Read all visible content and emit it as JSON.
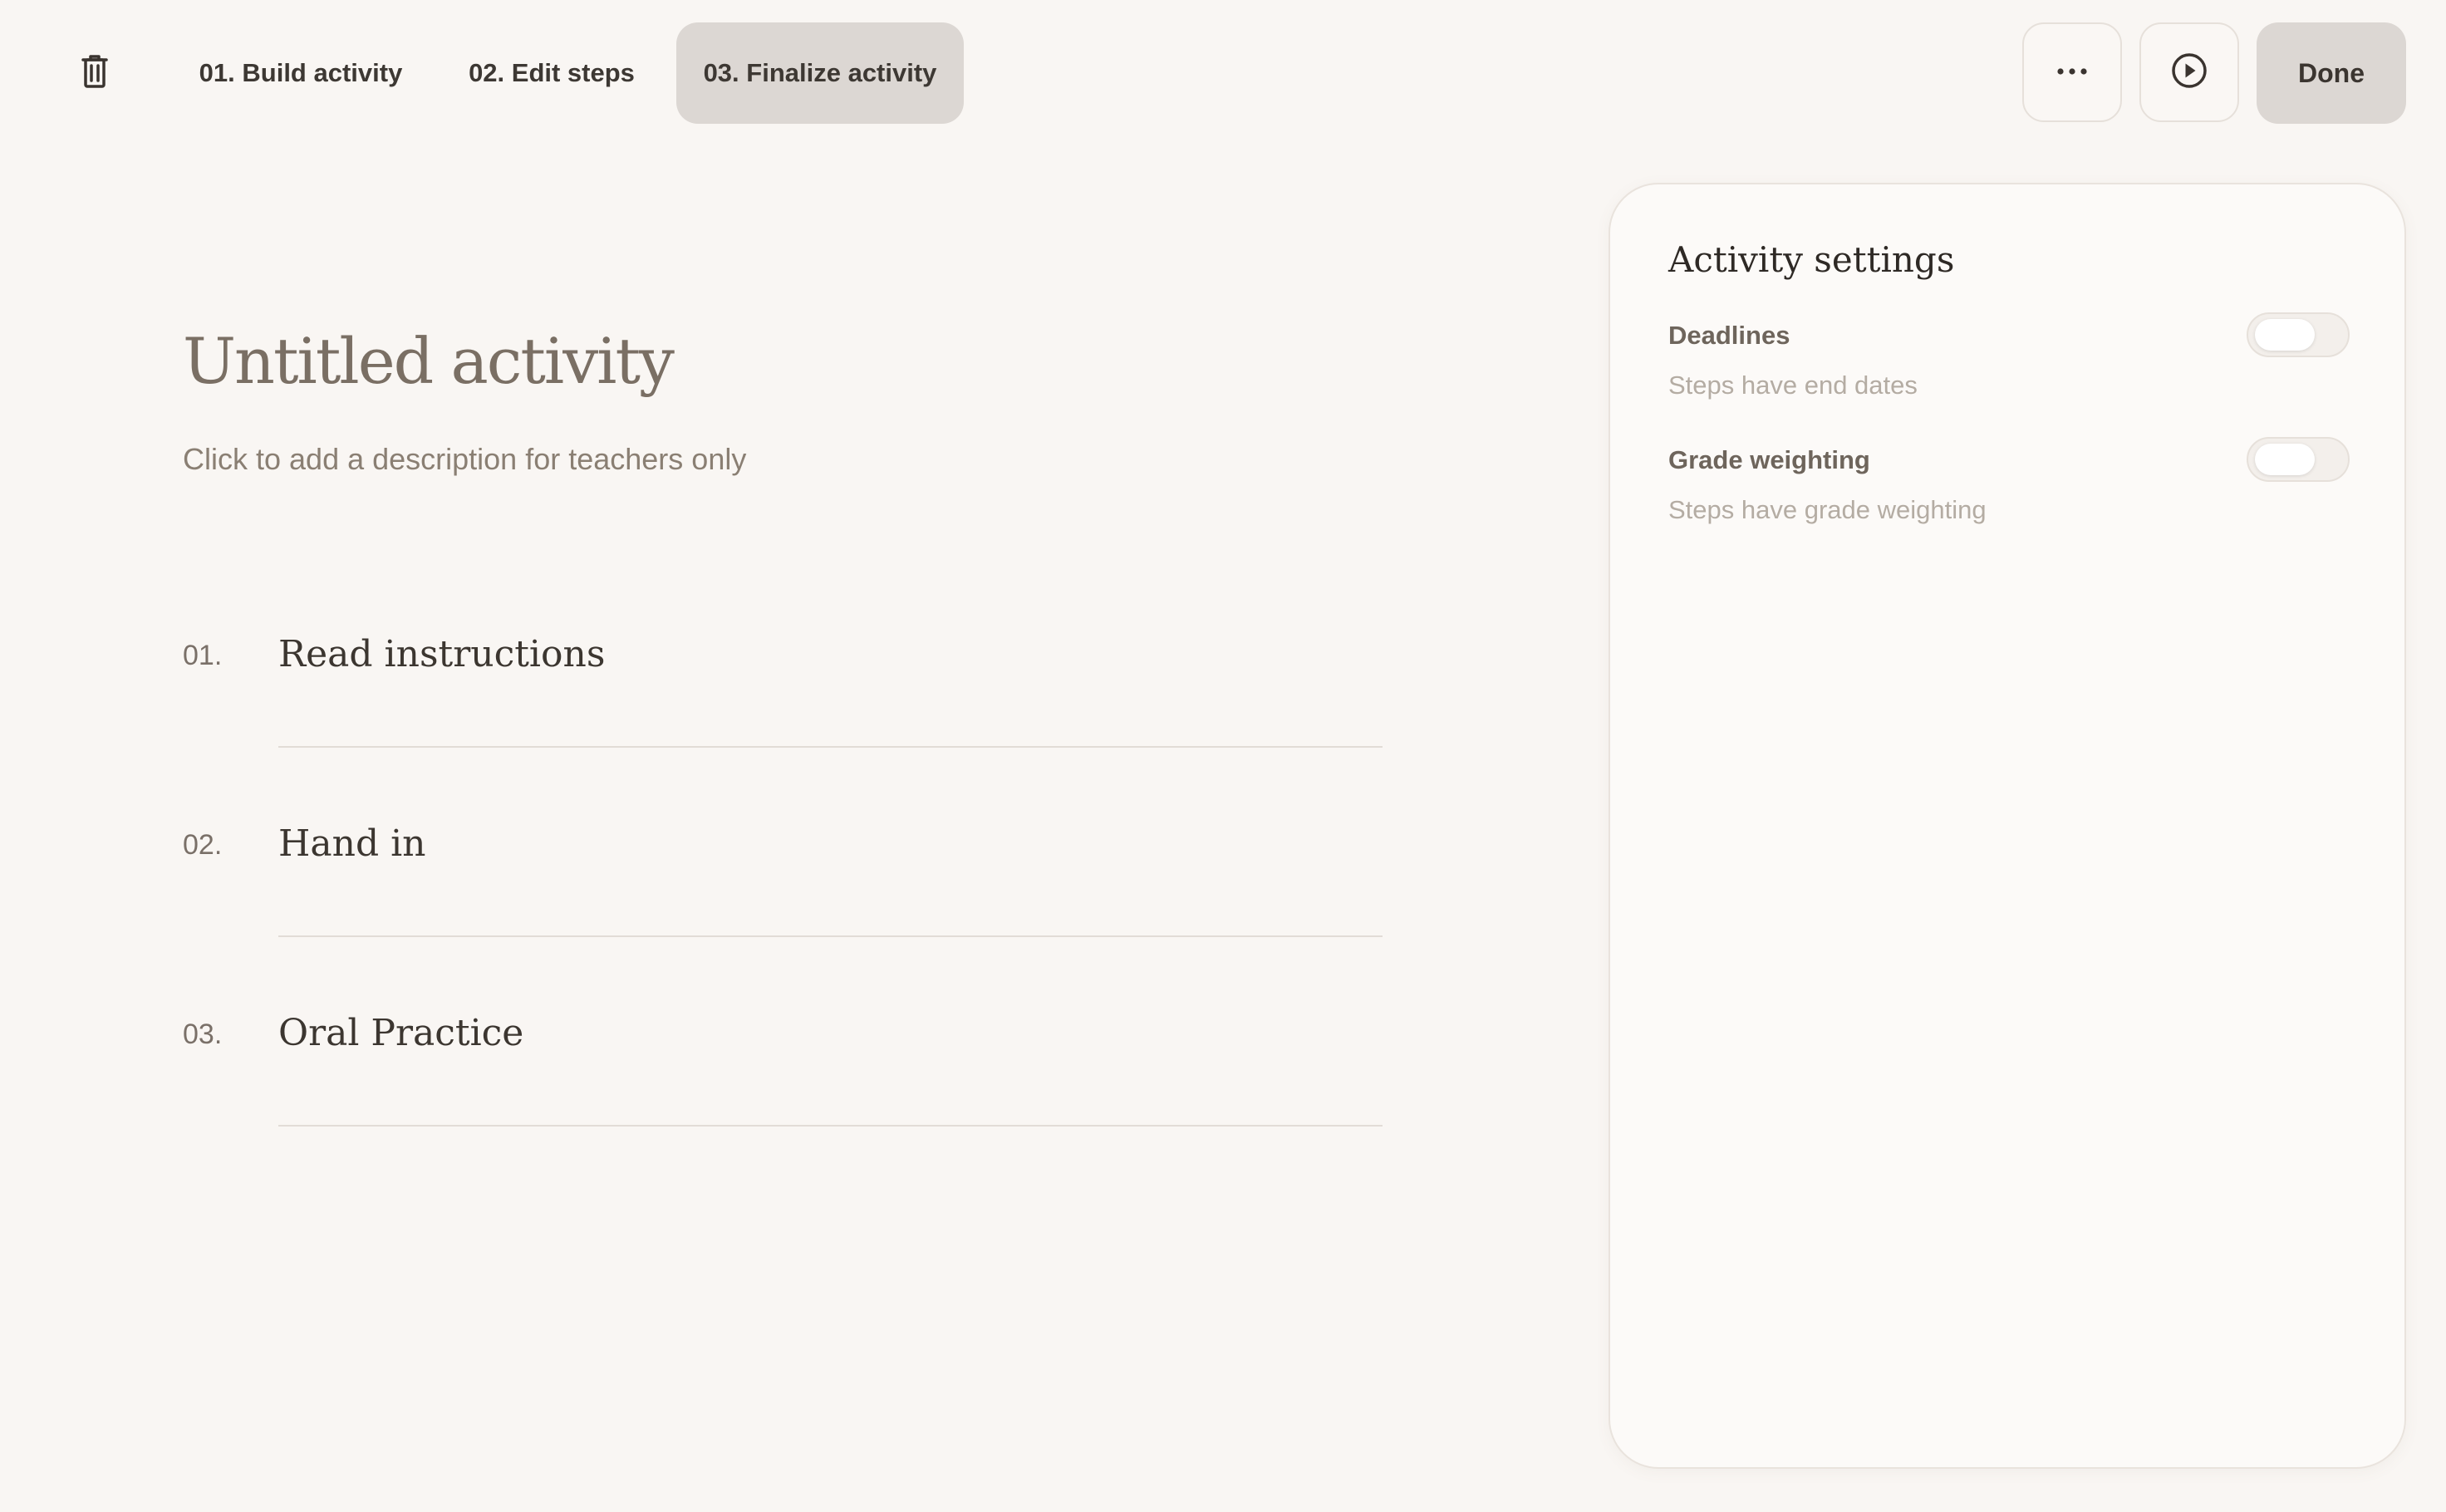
{
  "header": {
    "delete_icon": "trash-icon",
    "tabs": [
      {
        "label": "01. Build activity",
        "active": false
      },
      {
        "label": "02. Edit steps",
        "active": false
      },
      {
        "label": "03. Finalize activity",
        "active": true
      }
    ],
    "more_icon": "ellipsis-icon",
    "preview_icon": "play-circle-icon",
    "done_label": "Done"
  },
  "activity": {
    "title": "Untitled activity",
    "description_placeholder": "Click to add a description for teachers only",
    "steps": [
      {
        "number": "01.",
        "title": "Read instructions"
      },
      {
        "number": "02.",
        "title": "Hand in"
      },
      {
        "number": "03.",
        "title": "Oral Practice"
      }
    ]
  },
  "settings": {
    "title": "Activity settings",
    "items": [
      {
        "label": "Deadlines",
        "description": "Steps have end dates",
        "enabled": false
      },
      {
        "label": "Grade weighting",
        "description": "Steps have grade weighting",
        "enabled": false
      }
    ]
  },
  "colors": {
    "background": "#f9f6f3",
    "active_tab": "#dcd7d3",
    "panel": "#fcfaf8",
    "title_text": "#7a6f64"
  }
}
